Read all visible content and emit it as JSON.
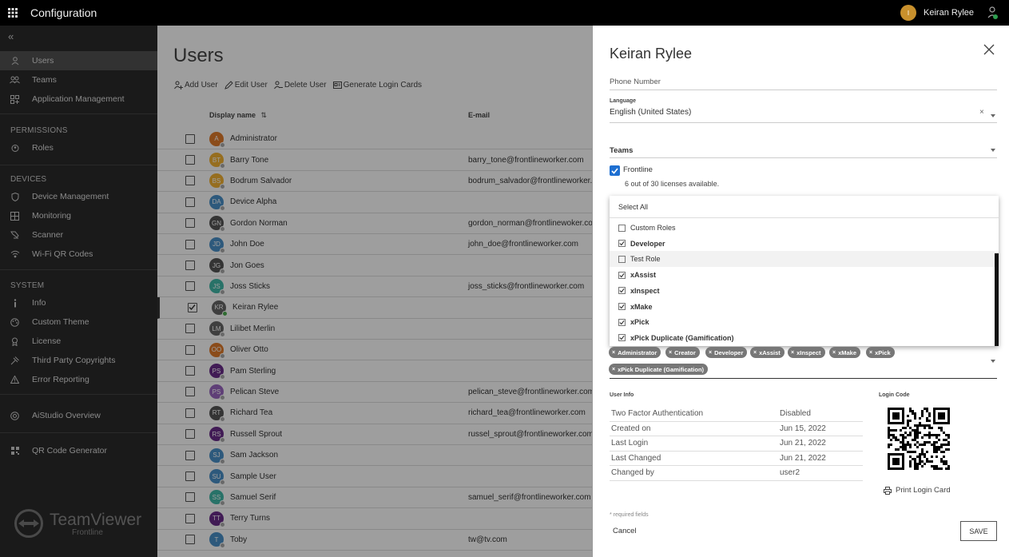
{
  "app": {
    "title": "Configuration",
    "user_initial": "I",
    "user_name": "Keiran Rylee"
  },
  "sidebar": {
    "items": [
      {
        "label": "Users",
        "icon": "person-icon"
      },
      {
        "label": "Teams",
        "icon": "team-icon"
      },
      {
        "label": "Application Management",
        "icon": "app-grid-icon"
      }
    ],
    "permissions_header": "PERMISSIONS",
    "permissions": [
      {
        "label": "Roles",
        "icon": "shield-user-icon"
      }
    ],
    "devices_header": "DEVICES",
    "devices": [
      {
        "label": "Device Management",
        "icon": "shield-icon"
      },
      {
        "label": "Monitoring",
        "icon": "grid-icon"
      },
      {
        "label": "Scanner",
        "icon": "scanner-icon"
      },
      {
        "label": "Wi-Fi QR Codes",
        "icon": "wifi-icon"
      }
    ],
    "system_header": "SYSTEM",
    "system": [
      {
        "label": "Info",
        "icon": "info-icon"
      },
      {
        "label": "Custom Theme",
        "icon": "palette-icon"
      },
      {
        "label": "License",
        "icon": "license-icon"
      },
      {
        "label": "Third Party Copyrights",
        "icon": "copyright-icon"
      },
      {
        "label": "Error Reporting",
        "icon": "warning-icon"
      }
    ],
    "aistudio": "AiStudio Overview",
    "qr_gen": "QR Code Generator",
    "logo_main": "TeamViewer",
    "logo_sub": "Frontline"
  },
  "main": {
    "title": "Users",
    "toolbar": {
      "add": "Add User",
      "edit": "Edit User",
      "delete": "Delete User",
      "generate": "Generate Login Cards"
    },
    "col_display": "Display name",
    "col_email": "E-mail",
    "rows": [
      {
        "i": "A",
        "name": "Administrator",
        "email": "",
        "color": "#e07b2a",
        "checked": false
      },
      {
        "i": "BT",
        "name": "Barry Tone",
        "email": "barry_tone@frontlineworker.com",
        "color": "#f2b233",
        "checked": false
      },
      {
        "i": "BS",
        "name": "Bodrum Salvador",
        "email": "bodrum_salvador@frontlineworker.com",
        "color": "#f2b233",
        "checked": false
      },
      {
        "i": "DA",
        "name": "Device Alpha",
        "email": "",
        "color": "#4a90c8",
        "checked": false
      },
      {
        "i": "GN",
        "name": "Gordon Norman",
        "email": "gordon_norman@frontlinewoker.com",
        "color": "#555555",
        "checked": false
      },
      {
        "i": "JD",
        "name": "John Doe",
        "email": "john_doe@frontlineworker.com",
        "color": "#4a90c8",
        "checked": false
      },
      {
        "i": "JG",
        "name": "Jon Goes",
        "email": "",
        "color": "#555555",
        "checked": false
      },
      {
        "i": "JS",
        "name": "Joss Sticks",
        "email": "joss_sticks@frontlineworker.com",
        "color": "#42b8a8",
        "checked": false
      },
      {
        "i": "KR",
        "name": "Keiran Rylee",
        "email": "",
        "color": "#666666",
        "checked": true
      },
      {
        "i": "LM",
        "name": "Lilibet Merlin",
        "email": "",
        "color": "#666666",
        "checked": false
      },
      {
        "i": "OO",
        "name": "Oliver Otto",
        "email": "",
        "color": "#e07b2a",
        "checked": false
      },
      {
        "i": "PS",
        "name": "Pam Sterling",
        "email": "",
        "color": "#6a2c8a",
        "checked": false
      },
      {
        "i": "PS",
        "name": "Pelican Steve",
        "email": "pelican_steve@frontlineworker.com",
        "color": "#9a67c0",
        "checked": false
      },
      {
        "i": "RT",
        "name": "Richard Tea",
        "email": "richard_tea@frontlineworker.com",
        "color": "#555555",
        "checked": false
      },
      {
        "i": "RS",
        "name": "Russell Sprout",
        "email": "russel_sprout@frontlineworker.com",
        "color": "#6a2c8a",
        "checked": false
      },
      {
        "i": "SJ",
        "name": "Sam Jackson",
        "email": "",
        "color": "#4a90c8",
        "checked": false
      },
      {
        "i": "SU",
        "name": "Sample User",
        "email": "",
        "color": "#4a90c8",
        "checked": false
      },
      {
        "i": "SS",
        "name": "Samuel Serif",
        "email": "samuel_serif@frontlineworker.com",
        "color": "#42b8a8",
        "checked": false
      },
      {
        "i": "TT",
        "name": "Terry Turns",
        "email": "",
        "color": "#6a2c8a",
        "checked": false
      },
      {
        "i": "T",
        "name": "Toby",
        "email": "tw@tv.com",
        "color": "#4a90c8",
        "checked": false
      }
    ]
  },
  "panel": {
    "title": "Keiran Rylee",
    "phone_label": "Phone Number",
    "language_label": "Language",
    "language_value": "English (United States)",
    "teams_label": "Teams",
    "team_name": "Frontline",
    "licenses": "6 out of 30 licenses available.",
    "select_all": "Select All",
    "roles": [
      {
        "label": "Custom Roles",
        "checked": false,
        "bold": false
      },
      {
        "label": "Developer",
        "checked": true,
        "bold": true
      },
      {
        "label": "Test Role",
        "checked": false,
        "bold": false
      },
      {
        "label": "xAssist",
        "checked": true,
        "bold": true
      },
      {
        "label": "xInspect",
        "checked": true,
        "bold": true
      },
      {
        "label": "xMake",
        "checked": true,
        "bold": true
      },
      {
        "label": "xPick",
        "checked": true,
        "bold": true
      },
      {
        "label": "xPick Duplicate (Gamification)",
        "checked": true,
        "bold": true
      }
    ],
    "chips": [
      "Administrator",
      "Creator",
      "Developer",
      "xAssist",
      "xInspect",
      "xMake",
      "xPick",
      "xPick Duplicate (Gamification)"
    ],
    "user_info_label": "User Info",
    "login_code_label": "Login Code",
    "info": [
      {
        "k": "Two Factor Authentication",
        "v": "Disabled"
      },
      {
        "k": "Created on",
        "v": "Jun 15, 2022"
      },
      {
        "k": "Last Login",
        "v": "Jun 21, 2022"
      },
      {
        "k": "Last Changed",
        "v": "Jun 21, 2022"
      },
      {
        "k": "Changed by",
        "v": "user2"
      }
    ],
    "print": "Print Login Card",
    "required": "* required fields",
    "cancel": "Cancel",
    "save": "SAVE"
  }
}
